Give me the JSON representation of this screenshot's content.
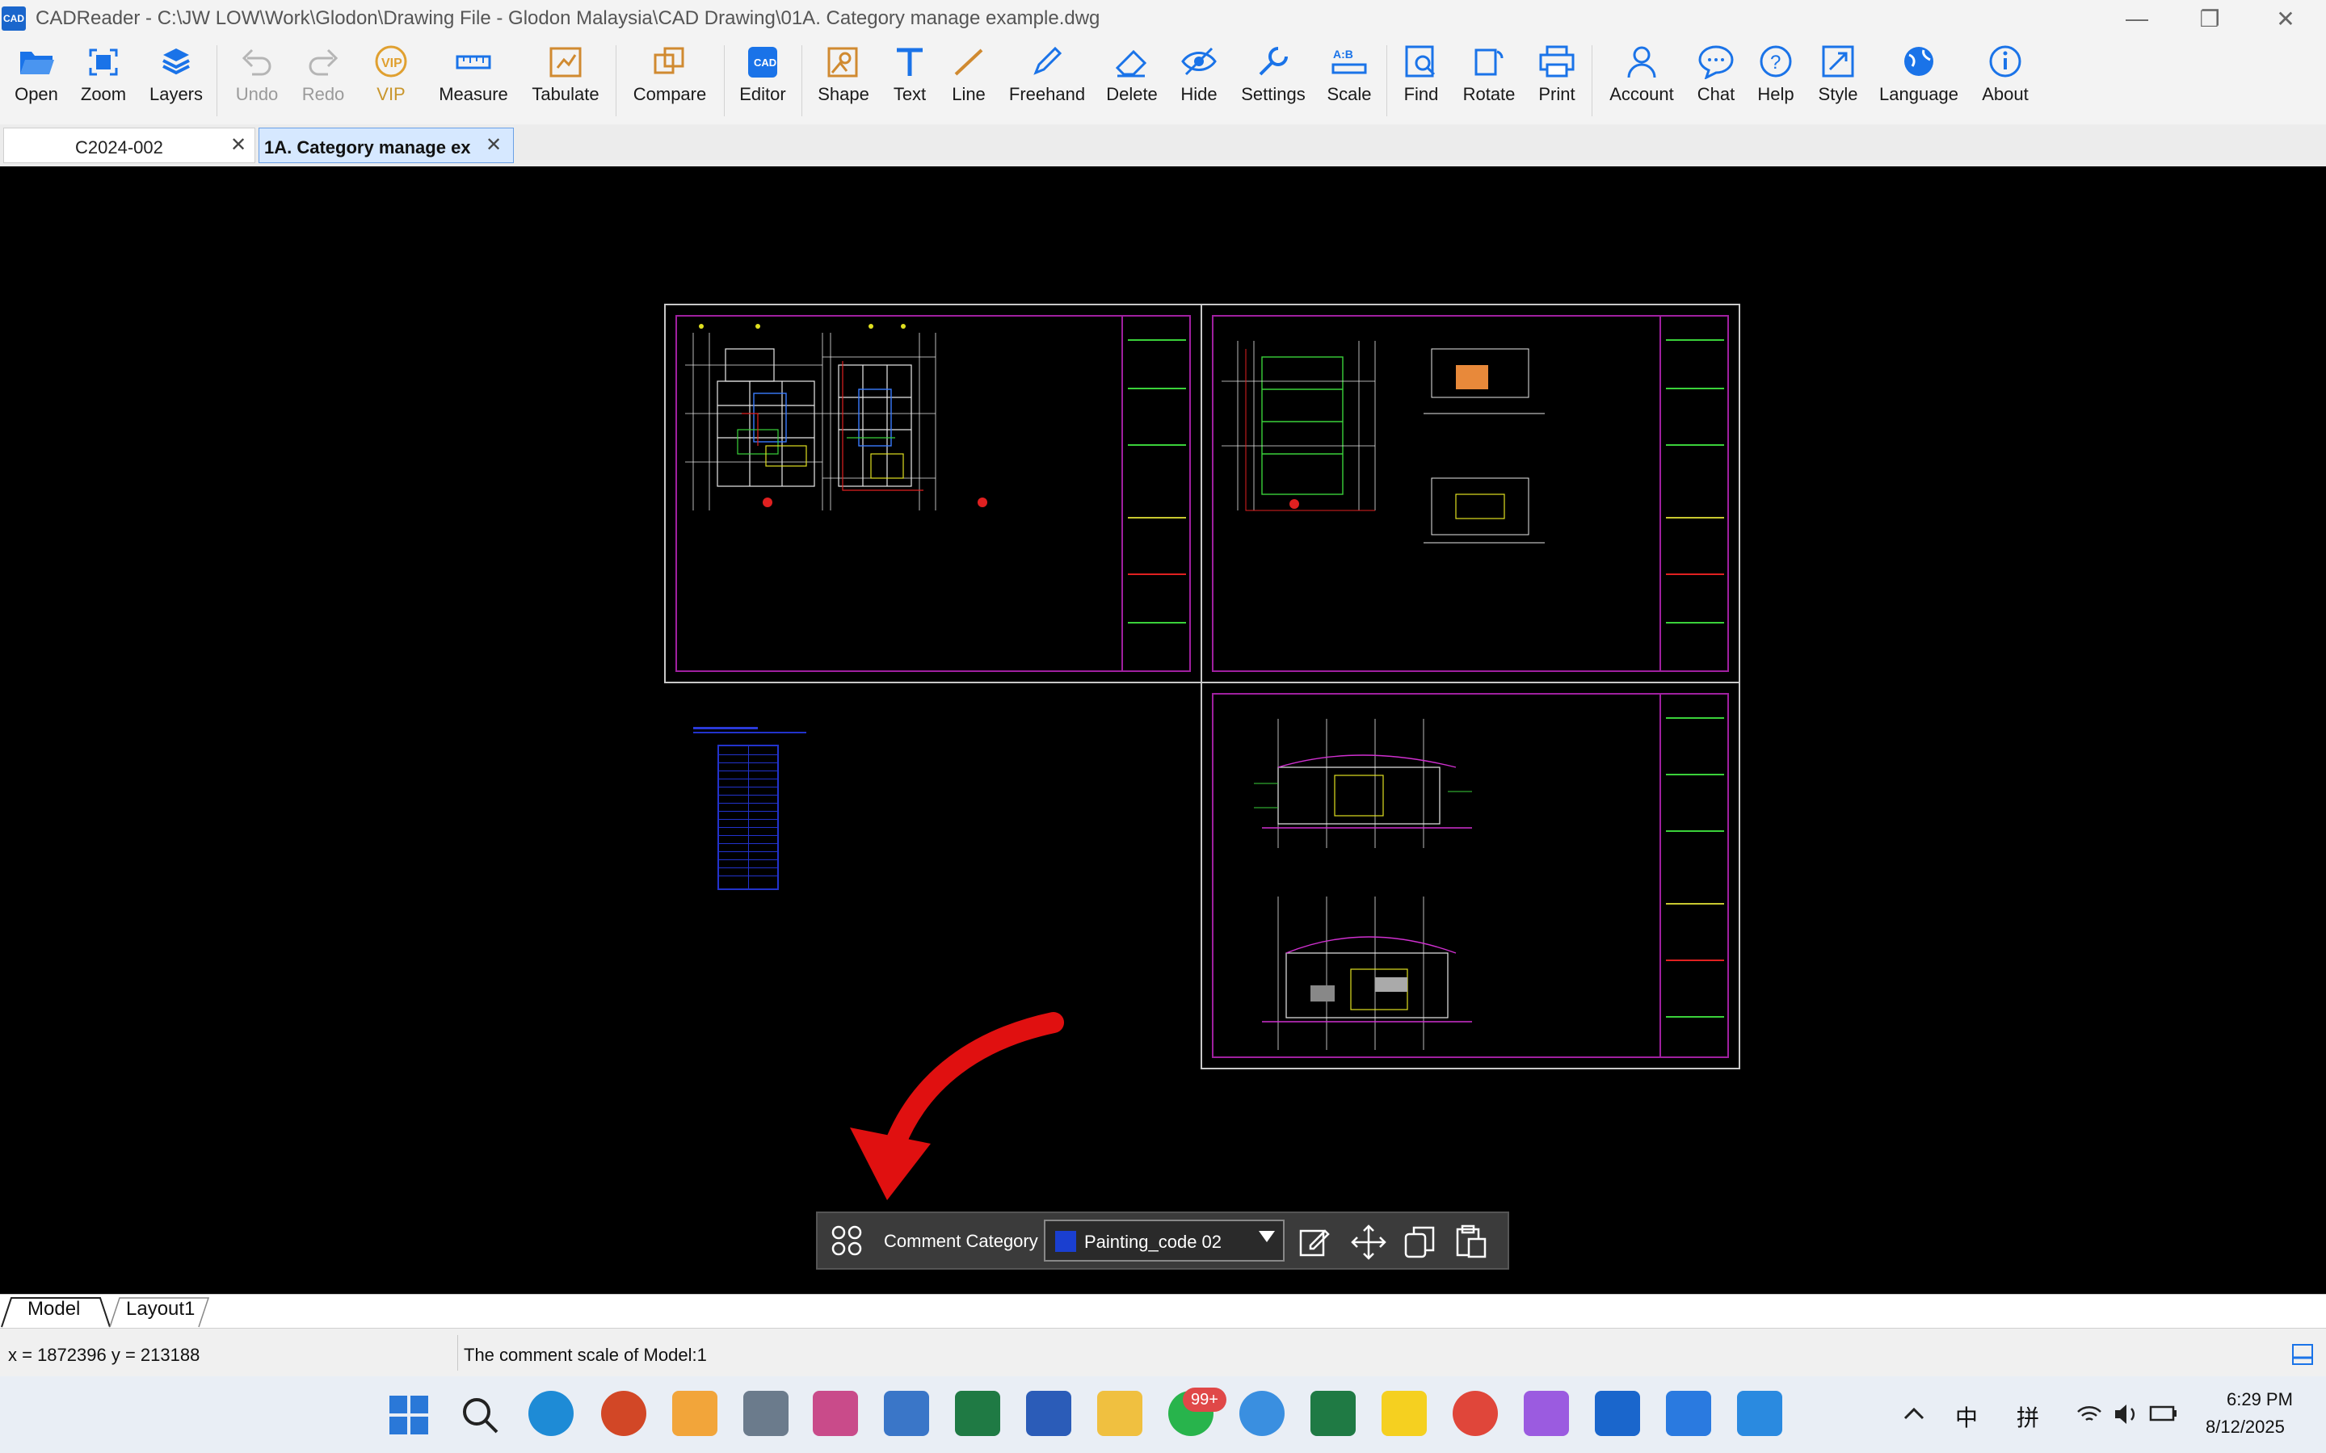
{
  "window": {
    "title": "CADReader - C:\\JW LOW\\Work\\Glodon\\Drawing File - Glodon Malaysia\\CAD Drawing\\01A. Category manage example.dwg",
    "logo_text": "CAD"
  },
  "toolbar": {
    "open": "Open",
    "zoom": "Zoom",
    "layers": "Layers",
    "undo": "Undo",
    "redo": "Redo",
    "vip": "VIP",
    "measure": "Measure",
    "tabulate": "Tabulate",
    "compare": "Compare",
    "editor": "Editor",
    "shape": "Shape",
    "text": "Text",
    "line": "Line",
    "freehand": "Freehand",
    "delete": "Delete",
    "hide": "Hide",
    "settings": "Settings",
    "scale": "Scale",
    "find": "Find",
    "rotate": "Rotate",
    "print": "Print",
    "account": "Account",
    "chat": "Chat",
    "help": "Help",
    "style": "Style",
    "language": "Language",
    "about": "About"
  },
  "tabs": [
    {
      "label": "C2024-002",
      "active": false
    },
    {
      "label": "1A. Category manage ex",
      "active": true
    }
  ],
  "comment_bar": {
    "label": "Comment Category",
    "selected": "Painting_code 02",
    "swatch_color": "#1a3fd0"
  },
  "layout_tabs": [
    "Model",
    "Layout1"
  ],
  "status": {
    "coords": "x = 1872396 y = 213188",
    "message": "The comment scale of Model:1"
  },
  "taskbar": {
    "badge": "99+",
    "tray_ime": "中",
    "tray_pinyin": "拼",
    "time": "6:29 PM",
    "date": "8/12/2025"
  },
  "colors": {
    "accent": "#1a73e8",
    "arrow": "#e01010",
    "frame": "#a020a0"
  }
}
